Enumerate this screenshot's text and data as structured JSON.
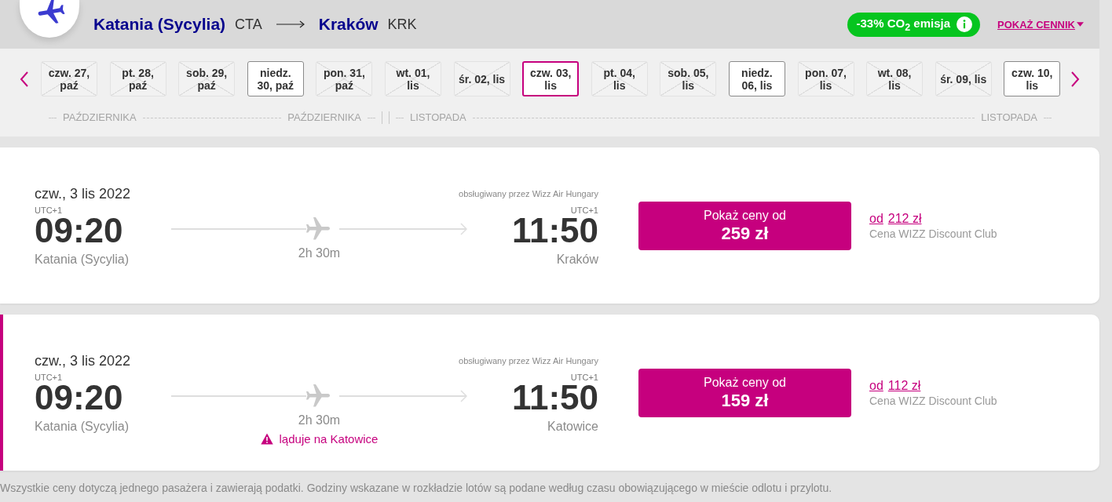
{
  "header": {
    "origin": {
      "city": "Katania (Sycylia)",
      "code": "CTA"
    },
    "destination": {
      "city": "Kraków",
      "code": "KRK"
    },
    "co2_badge": "-33% CO$_{2}$ emisja",
    "price_calendar_link": "POKAŻ CENNIK"
  },
  "date_strip": {
    "dates": [
      {
        "label_lines": [
          "czw. 27,",
          "paź"
        ],
        "disabled": true,
        "selected": false
      },
      {
        "label_lines": [
          "pt. 28,",
          "paź"
        ],
        "disabled": true,
        "selected": false
      },
      {
        "label_lines": [
          "sob. 29,",
          "paź"
        ],
        "disabled": true,
        "selected": false
      },
      {
        "label_lines": [
          "niedz.",
          "30, paź"
        ],
        "disabled": false,
        "selected": false
      },
      {
        "label_lines": [
          "pon. 31,",
          "paź"
        ],
        "disabled": true,
        "selected": false
      },
      {
        "label_lines": [
          "wt. 01,",
          "lis"
        ],
        "disabled": true,
        "selected": false
      },
      {
        "label_lines": [
          "śr. 02, lis"
        ],
        "disabled": true,
        "selected": false
      },
      {
        "label_lines": [
          "czw. 03,",
          "lis"
        ],
        "disabled": false,
        "selected": true
      },
      {
        "label_lines": [
          "pt. 04,",
          "lis"
        ],
        "disabled": true,
        "selected": false
      },
      {
        "label_lines": [
          "sob. 05,",
          "lis"
        ],
        "disabled": true,
        "selected": false
      },
      {
        "label_lines": [
          "niedz.",
          "06, lis"
        ],
        "disabled": false,
        "selected": false
      },
      {
        "label_lines": [
          "pon. 07,",
          "lis"
        ],
        "disabled": true,
        "selected": false
      },
      {
        "label_lines": [
          "wt. 08,",
          "lis"
        ],
        "disabled": true,
        "selected": false
      },
      {
        "label_lines": [
          "śr. 09, lis"
        ],
        "disabled": true,
        "selected": false
      },
      {
        "label_lines": [
          "czw. 10,",
          "lis"
        ],
        "disabled": false,
        "selected": false
      }
    ],
    "months": [
      {
        "labels": [
          "PAŹDZIERNIKA",
          "PAŹDZIERNIKA"
        ]
      },
      {
        "labels": [
          "LISTOPADA",
          "LISTOPADA"
        ]
      }
    ]
  },
  "flights": [
    {
      "selected": false,
      "date": "czw., 3 lis 2022",
      "operator": "obsługiwany przez Wizz Air Hungary",
      "departure": {
        "timezone": "UTC+1",
        "time": "09:20",
        "city": "Katania (Sycylia)"
      },
      "duration": "2h 30m",
      "arrival": {
        "timezone": "UTC+1",
        "time": "11:50",
        "city": "Kraków"
      },
      "price_button": {
        "label": "Pokaż ceny od",
        "price": "259 zł"
      },
      "club_price": {
        "prefix": "od",
        "price": "212 zł",
        "caption": "Cena WIZZ Discount Club"
      }
    },
    {
      "selected": true,
      "date": "czw., 3 lis 2022",
      "operator": "obsługiwany przez Wizz Air Hungary",
      "departure": {
        "timezone": "UTC+1",
        "time": "09:20",
        "city": "Katania (Sycylia)"
      },
      "duration": "2h 30m",
      "warning": "ląduje na Katowice",
      "arrival": {
        "timezone": "UTC+1",
        "time": "11:50",
        "city": "Katowice"
      },
      "price_button": {
        "label": "Pokaż ceny od",
        "price": "159 zł"
      },
      "club_price": {
        "prefix": "od",
        "price": "112 zł",
        "caption": "Cena WIZZ Discount Club"
      }
    }
  ],
  "footer_note": "Wszystkie ceny dotyczą jednego pasażera i zawierają podatki. Godziny wskazane w rozkładzie lotów są podane według czasu obowiązującego w mieście odlotu i przylotu."
}
